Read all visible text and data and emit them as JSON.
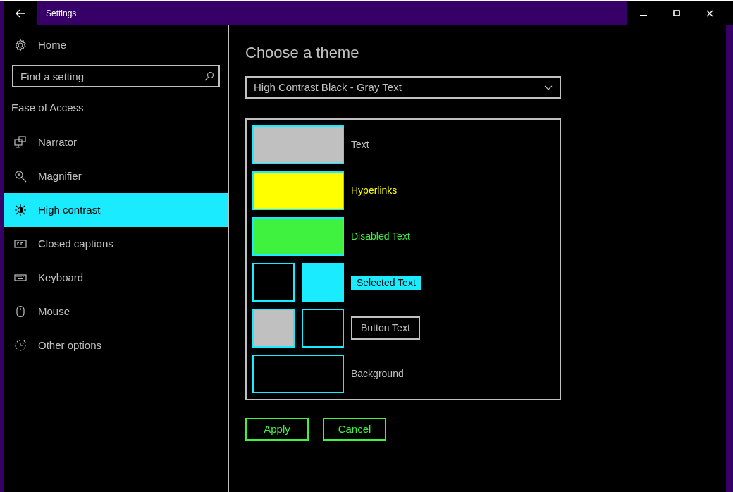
{
  "window": {
    "title": "Settings"
  },
  "sidebar": {
    "home": "Home",
    "search": {
      "placeholder": "Find a setting"
    },
    "section": "Ease of Access",
    "items": [
      {
        "label": "Narrator",
        "selected": false
      },
      {
        "label": "Magnifier",
        "selected": false
      },
      {
        "label": "High contrast",
        "selected": true
      },
      {
        "label": "Closed captions",
        "selected": false
      },
      {
        "label": "Keyboard",
        "selected": false
      },
      {
        "label": "Mouse",
        "selected": false
      },
      {
        "label": "Other options",
        "selected": false
      }
    ]
  },
  "content": {
    "heading": "Choose a theme",
    "theme_dropdown": {
      "value": "High Contrast Black - Gray Text"
    },
    "theme_rows": [
      {
        "kind": "swatch",
        "label": "Text",
        "color": "#c0c0c0"
      },
      {
        "kind": "swatch",
        "label": "Hyperlinks",
        "color": "#ffff00"
      },
      {
        "kind": "swatch",
        "label": "Disabled Text",
        "color": "#3ff23f"
      },
      {
        "kind": "selection",
        "label": "Selected Text",
        "swatches": [
          {
            "color": "#000000"
          },
          {
            "color": "#1aebff"
          }
        ]
      },
      {
        "kind": "button",
        "label": "Button Text",
        "swatches": [
          {
            "color": "#c0c0c0"
          },
          {
            "color": "#000000"
          }
        ]
      },
      {
        "kind": "background",
        "label": "Background",
        "color": "#000000"
      }
    ],
    "buttons": [
      "Apply",
      "Cancel"
    ]
  }
}
